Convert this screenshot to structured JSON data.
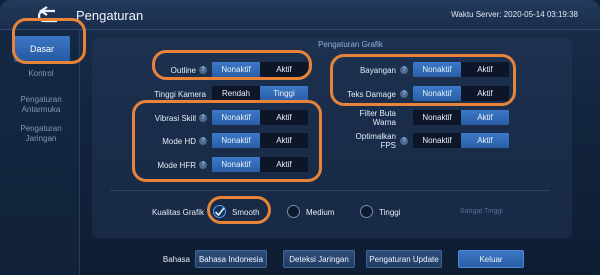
{
  "header": {
    "title": "Pengaturan",
    "server_time": "Waktu Server: 2020-05-14 03:19:38"
  },
  "sidebar": {
    "items": [
      {
        "label": "Dasar",
        "active": true
      },
      {
        "label": "Kontrol"
      },
      {
        "label": "Pengaturan Antarmuka"
      },
      {
        "label": "Pengaturan Jaringan"
      }
    ]
  },
  "graphics": {
    "section_title": "Pengaturan Grafik",
    "outline": {
      "label": "Outline",
      "options": [
        "Nonaktif",
        "Aktif"
      ],
      "selected": "Nonaktif"
    },
    "camera_height": {
      "label": "Tinggi Kamera",
      "options": [
        "Rendah",
        "Tinggi"
      ],
      "selected": "Tinggi"
    },
    "skill_vibration": {
      "label": "Vibrasi Skill",
      "options": [
        "Nonaktif",
        "Aktif"
      ],
      "selected": "Nonaktif"
    },
    "hd_mode": {
      "label": "Mode HD",
      "options": [
        "Nonaktif",
        "Aktif"
      ],
      "selected": "Nonaktif"
    },
    "hfr_mode": {
      "label": "Mode HFR",
      "options": [
        "Nonaktif",
        "Aktif"
      ],
      "selected": "Nonaktif"
    },
    "shadow": {
      "label": "Bayangan",
      "options": [
        "Nonaktif",
        "Aktif"
      ],
      "selected": "Nonaktif"
    },
    "damage_text": {
      "label": "Teks Damage",
      "options": [
        "Nonaktif",
        "Aktif"
      ],
      "selected": "Nonaktif"
    },
    "color_blind_filter": {
      "label": "Filter Buta Warna",
      "options": [
        "Nonaktif",
        "Aktif"
      ],
      "selected": "Aktif"
    },
    "optimize_fps": {
      "label": "Optimalkan FPS",
      "options": [
        "Nonaktif",
        "Aktif"
      ],
      "selected": "Aktif"
    }
  },
  "quality": {
    "label": "Kualitas Grafik",
    "options": [
      "Smooth",
      "Medium",
      "Tinggi"
    ],
    "selected": "Smooth",
    "extra_label": "Sangat Tinggi"
  },
  "bottom": {
    "language_label": "Bahasa",
    "language_value": "Bahasa Indonesia",
    "detect_network": "Deteksi Jaringan",
    "update_settings": "Pengaturan Update",
    "exit": "Keluar"
  },
  "colors": {
    "accent": "#3b76c3",
    "annotation": "#e8843a"
  }
}
